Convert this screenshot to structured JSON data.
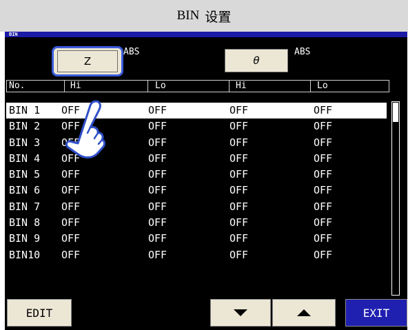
{
  "title_bar": {
    "title": "BIN",
    "subtitle": "设置"
  },
  "screen": {
    "header_label": "BIN"
  },
  "params": {
    "z_label": "Z",
    "theta_label": "θ",
    "abs_1": "ABS",
    "abs_2": "ABS"
  },
  "columns": {
    "no": "No.",
    "hi_1": "Hi",
    "lo_1": "Lo",
    "hi_2": "Hi",
    "lo_2": "Lo"
  },
  "rows": [
    {
      "no": "BIN 1",
      "v": [
        "OFF",
        "OFF",
        "OFF",
        "OFF"
      ]
    },
    {
      "no": "BIN 2",
      "v": [
        "OFF",
        "OFF",
        "OFF",
        "OFF"
      ]
    },
    {
      "no": "BIN 3",
      "v": [
        "OFF",
        "OFF",
        "OFF",
        "OFF"
      ]
    },
    {
      "no": "BIN 4",
      "v": [
        "OFF",
        "OFF",
        "OFF",
        "OFF"
      ]
    },
    {
      "no": "BIN 5",
      "v": [
        "OFF",
        "OFF",
        "OFF",
        "OFF"
      ]
    },
    {
      "no": "BIN 6",
      "v": [
        "OFF",
        "OFF",
        "OFF",
        "OFF"
      ]
    },
    {
      "no": "BIN 7",
      "v": [
        "OFF",
        "OFF",
        "OFF",
        "OFF"
      ]
    },
    {
      "no": "BIN 8",
      "v": [
        "OFF",
        "OFF",
        "OFF",
        "OFF"
      ]
    },
    {
      "no": "BIN 9",
      "v": [
        "OFF",
        "OFF",
        "OFF",
        "OFF"
      ]
    },
    {
      "no": "BIN10",
      "v": [
        "OFF",
        "OFF",
        "OFF",
        "OFF"
      ]
    }
  ],
  "selected_row": 0,
  "bottom": {
    "edit_label": "EDIT",
    "exit_label": "EXIT"
  },
  "icons": {
    "down": "arrow-down-icon",
    "up": "arrow-up-icon",
    "pointer": "hand-pointer-icon"
  },
  "colors": {
    "header_blue": "#1a1aa6",
    "exit_blue": "#1f1fb0",
    "highlight_blue": "#3b5bdb",
    "button_beige": "#ece7d5"
  }
}
